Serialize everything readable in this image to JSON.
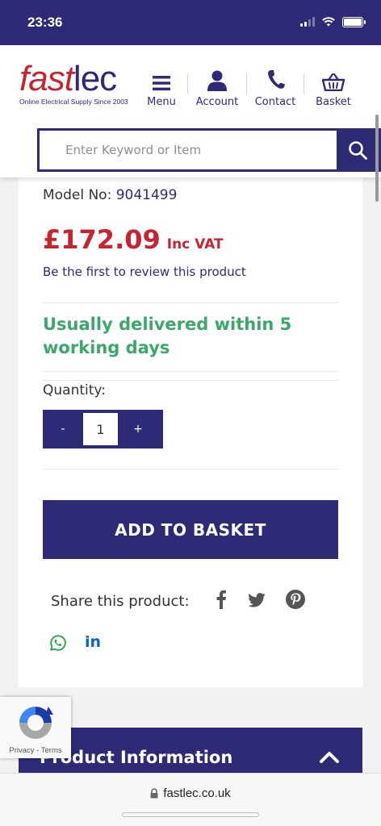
{
  "status_bar": {
    "time": "23:36"
  },
  "header": {
    "logo": {
      "fast": "fast",
      "lec": "lec",
      "tagline": "Online Electrical Supply Since 2003"
    },
    "nav": [
      {
        "label": "Menu",
        "icon": "menu-icon"
      },
      {
        "label": "Account",
        "icon": "account-icon"
      },
      {
        "label": "Contact",
        "icon": "phone-icon"
      },
      {
        "label": "Basket",
        "icon": "basket-icon"
      }
    ],
    "search": {
      "placeholder": "Enter Keyword or Item",
      "button_icon": "search-icon"
    }
  },
  "product": {
    "model_label": "Model No:",
    "model_value": "9041499",
    "price": "£172.09",
    "price_suffix": "Inc VAT",
    "review_link": "Be the first to review this product",
    "delivery_text": "Usually delivered within 5 working days",
    "quantity_label": "Quantity:",
    "quantity_minus": "-",
    "quantity_value": "1",
    "quantity_plus": "+",
    "add_to_basket": "ADD TO BASKET",
    "share_label": "Share this product:",
    "share_icons": [
      "facebook-icon",
      "twitter-icon",
      "pinterest-icon",
      "whatsapp-icon",
      "linkedin-icon"
    ],
    "linkedin_text": "in"
  },
  "product_info": {
    "title": "Product Information"
  },
  "recaptcha": {
    "links": "Privacy - Terms"
  },
  "browser": {
    "url": "fastlec.co.uk"
  },
  "colors": {
    "brand_navy": "#2e2a76",
    "brand_red": "#c8242f",
    "delivery_green": "#3aa86b",
    "whatsapp_green": "#25a244",
    "linkedin_blue": "#0a66c2"
  }
}
